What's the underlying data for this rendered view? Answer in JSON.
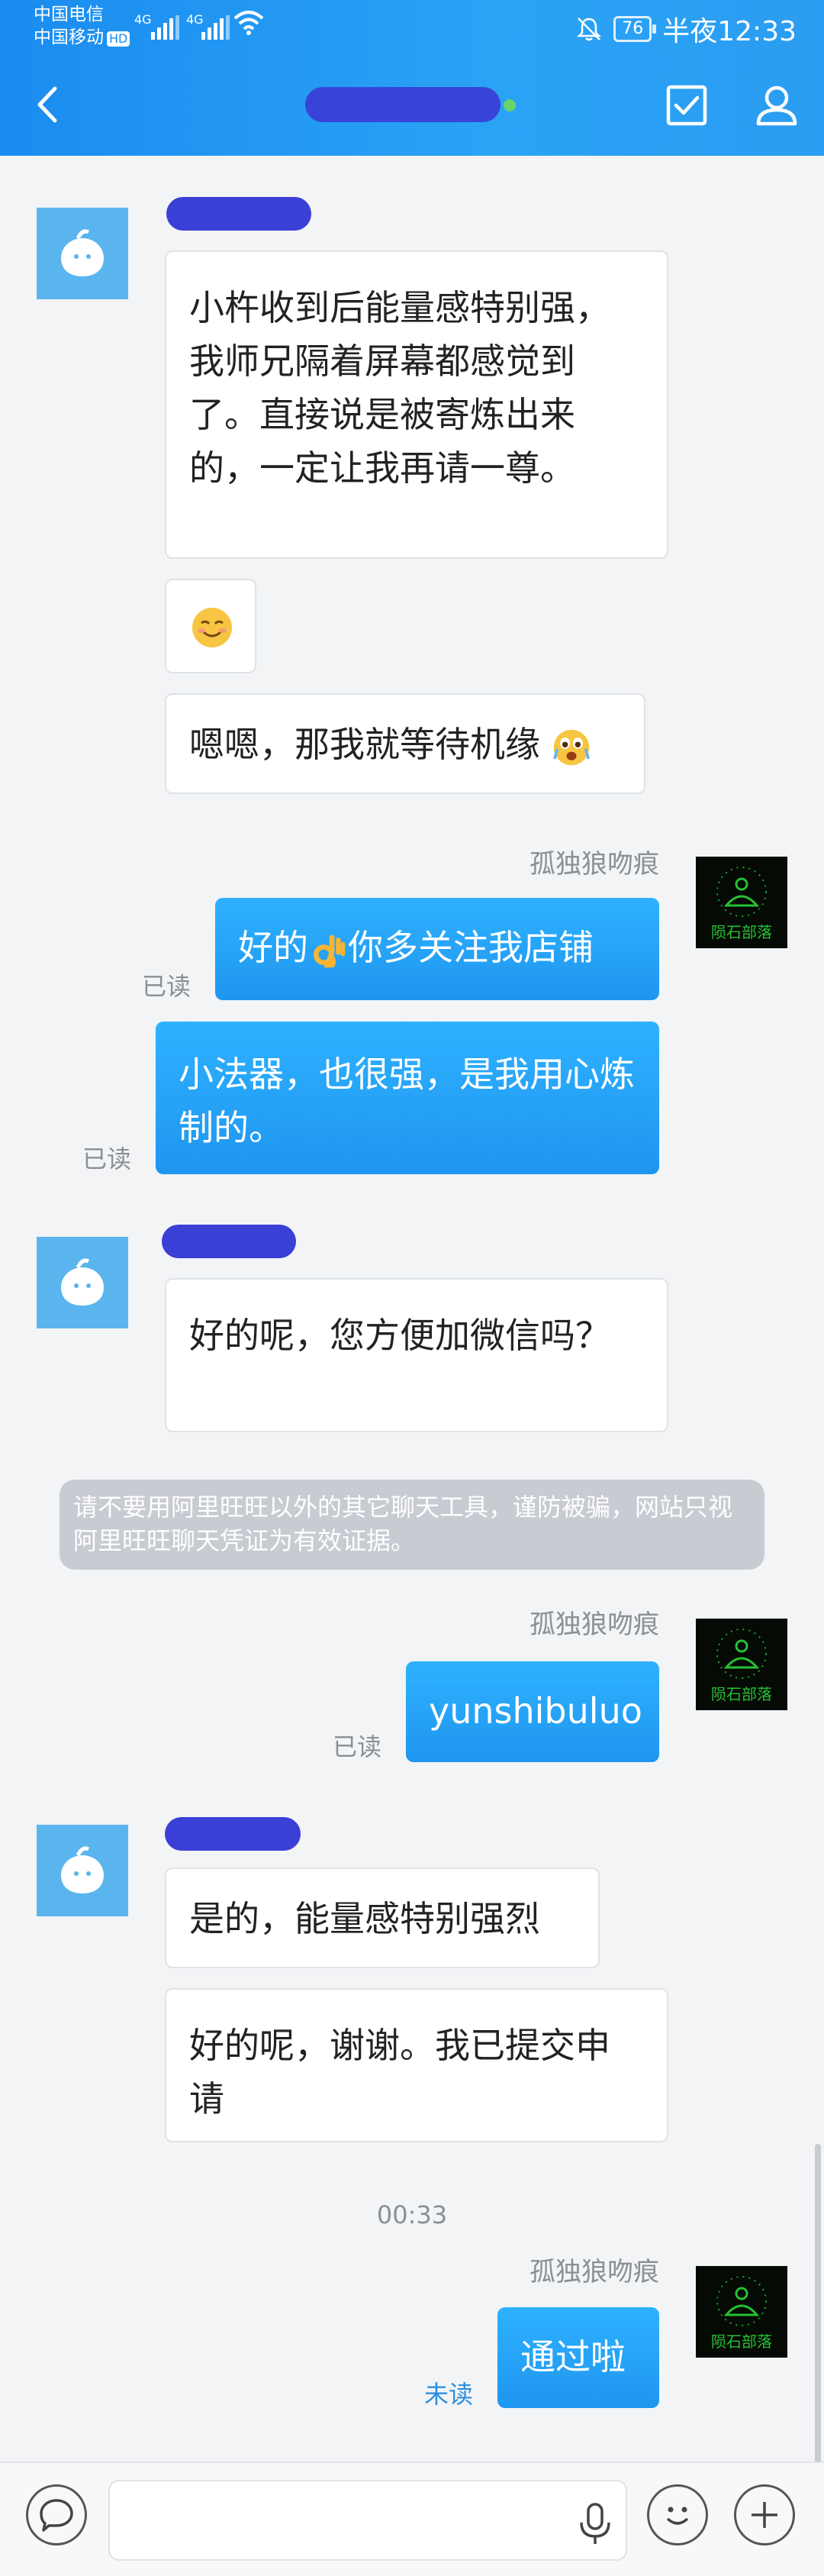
{
  "status_bar": {
    "carrier1": "中国电信",
    "carrier2": "中国移动",
    "hd": "HD",
    "net1": "4G",
    "net2": "4G",
    "battery": "76",
    "time": "半夜12:33"
  },
  "header": {
    "colors": {
      "gradient_start": "#1a8cf0",
      "gradient_end": "#2b9df2"
    },
    "icons": [
      "back-arrow-icon",
      "checkbox-icon",
      "user-icon"
    ]
  },
  "messages": {
    "m1_text": "小杵收到后能量感特别强，我师兄隔着屏幕都感觉到了。直接说是被寄炼出来的，一定让我再请一尊。",
    "m3_text": "嗯嗯，那我就等待机缘",
    "sender1": "孤独狼吻痕",
    "m4_before": "好的",
    "m4_after": "你多关注我店铺",
    "read1": "已读",
    "m5_text": "小法器，也很强，是我用心炼制的。",
    "read2": "已读",
    "m6_text": "好的呢，您方便加微信吗？",
    "notice": "请不要用阿里旺旺以外的其它聊天工具，谨防被骗，网站只视阿里旺旺聊天凭证为有效证据。",
    "sender2": "孤独狼吻痕",
    "m7_text": "yunshibuluo",
    "read3": "已读",
    "m8_text": "是的，能量感特别强烈",
    "m9_text": "好的呢，谢谢。我已提交申请",
    "time_divider": "00:33",
    "sender3": "孤独狼吻痕",
    "m10_text": "通过啦",
    "unread": "未读"
  },
  "avatar_right_text": "陨石部落",
  "input_bar": {
    "value": "",
    "icons": [
      "chat-bubble-icon",
      "microphone-icon",
      "smiley-icon",
      "plus-icon"
    ]
  }
}
